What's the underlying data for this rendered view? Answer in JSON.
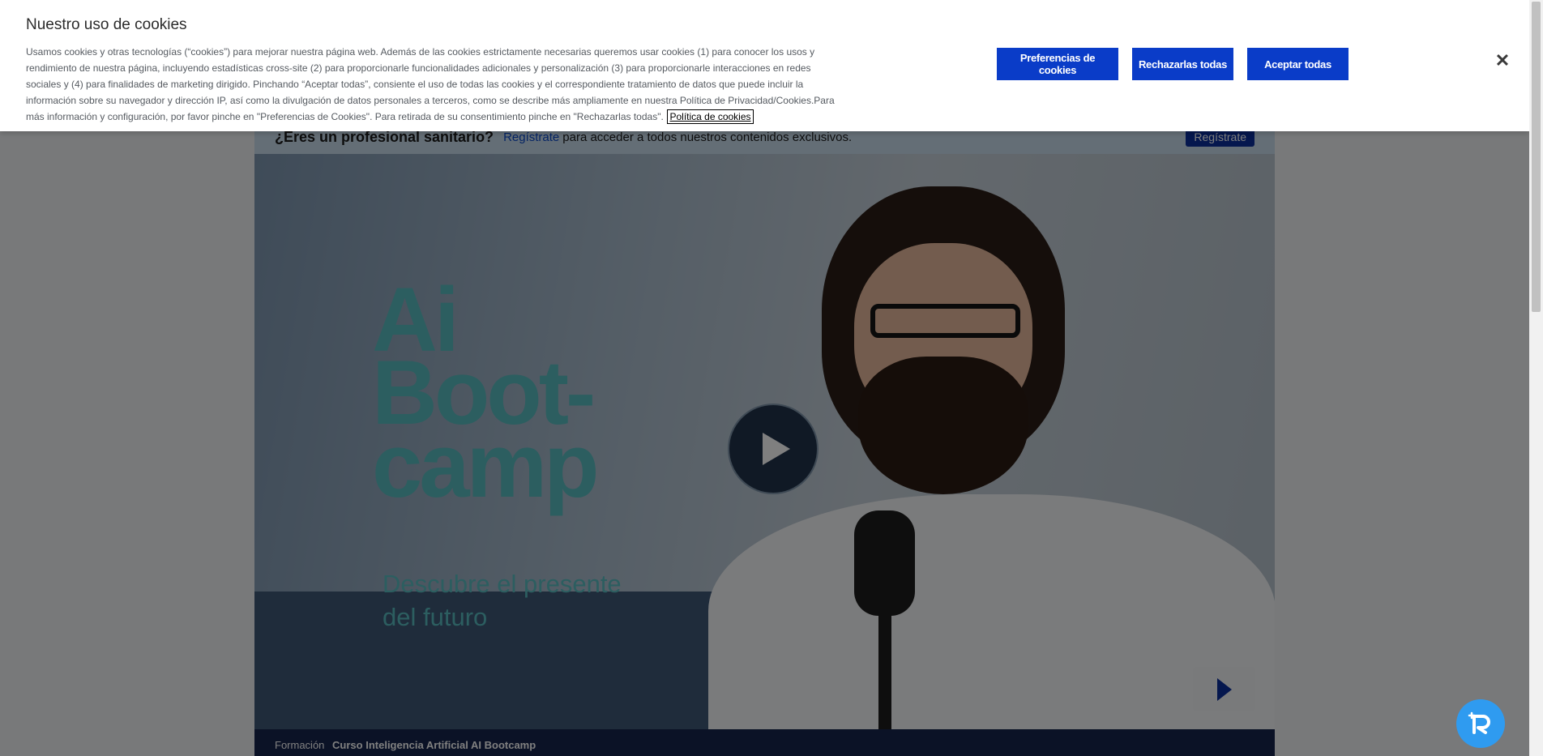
{
  "cookie_banner": {
    "title": "Nuestro uso de cookies",
    "body": "Usamos cookies y otras tecnologías (“cookies”) para mejorar nuestra página web. Además de las cookies estrictamente necesarias queremos usar cookies (1) para conocer los usos y rendimiento de nuestra página, incluyendo estadísticas cross-site (2) para proporcionarle funcionalidades adicionales y personalización (3) para proporcionarle interacciones en redes sociales y (4) para finalidades de marketing dirigido. Pinchando “Aceptar todas”, consiente el uso de todas las cookies y el correspondiente tratamiento de datos que puede incluir la información sobre su navegador y dirección IP, así como la divulgación de datos personales a terceros, como se describe más ampliamente en nuestra Política de Privacidad/Cookies.Para más información y configuración, por favor pinche en \"Preferencias de Cookies\". Para retirada de su consentimiento pinche en \"Rechazarlas todas\".",
    "policy_link": "Política de cookies",
    "preferences_button": "Preferencias de cookies",
    "reject_button": "Rechazarlas todas",
    "accept_button": "Aceptar todas",
    "close_icon": "close-icon"
  },
  "professional_bar": {
    "question": "¿Eres un profesional sanitario?",
    "link": "Regístrate",
    "rest": "para acceder a todos nuestros contenidos exclusivos.",
    "button": "Regístrate"
  },
  "hero": {
    "title_line1": "Ai",
    "title_line2": "Boot-",
    "title_line3": "camp",
    "subtitle_line1": "Descubre el presente",
    "subtitle_line2": "del futuro",
    "play_icon": "play-icon"
  },
  "info_bar": {
    "label": "Formación",
    "title": "Curso Inteligencia Artificial AI Bootcamp"
  },
  "colors": {
    "accent_blue": "#0a3cc8",
    "teal_title": "#59bcc0",
    "fab_blue": "#2f9bf0"
  },
  "fab": {
    "icon": "chat-assistant-icon"
  }
}
